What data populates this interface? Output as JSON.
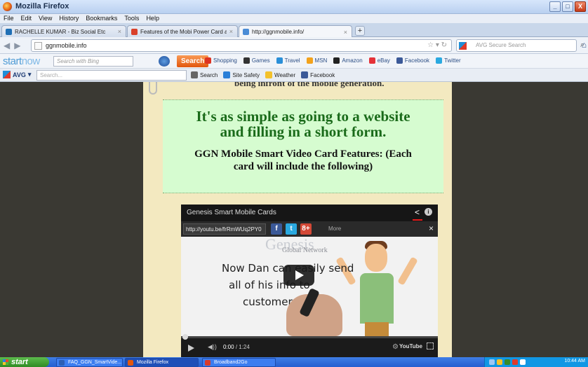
{
  "window": {
    "title": "Mozilla Firefox",
    "buttons": [
      "_",
      "□",
      "X"
    ]
  },
  "menu": [
    "File",
    "Edit",
    "View",
    "History",
    "Bookmarks",
    "Tools",
    "Help"
  ],
  "tabs": [
    {
      "label": "RACHELLE KUMAR - Biz Social Etc",
      "close": "×",
      "icon_color": "#1f6fb5"
    },
    {
      "label": "Features of the Mobi Power Card and W...",
      "close": "×",
      "icon_color": "#d9412b"
    },
    {
      "label": "http://ggnmobile.info/",
      "close": "×",
      "icon_color": "#4a8cd6"
    }
  ],
  "new_tab": "+",
  "nav": {
    "url": "ggnmobile.info",
    "search_placeholder": "AVG Secure Search"
  },
  "startnow_bar": {
    "logo_start": "start",
    "logo_now": "now",
    "search_placeholder": "Search with Bing",
    "search_button": "Search",
    "links": [
      {
        "label": "Shopping",
        "color": "#d32"
      },
      {
        "label": "Games",
        "color": "#333"
      },
      {
        "label": "Travel",
        "color": "#2a8fd8"
      },
      {
        "label": "MSN",
        "color": "#f3a21b"
      },
      {
        "label": "Amazon",
        "color": "#222"
      },
      {
        "label": "eBay",
        "color": "#e53238"
      },
      {
        "label": "Facebook",
        "color": "#3b5998"
      },
      {
        "label": "Twitter",
        "color": "#2aa9e0"
      }
    ]
  },
  "avg_bar": {
    "logo": "AVG",
    "search_placeholder": "Search...",
    "links": [
      {
        "label": "Search",
        "color": "#666"
      },
      {
        "label": "Site Safety",
        "color": "#2a7fd8"
      },
      {
        "label": "Weather",
        "color": "#f3c12b"
      },
      {
        "label": "Facebook",
        "color": "#3b5998"
      }
    ]
  },
  "page": {
    "clipped_text": "being infront of the mobile generation.",
    "headline": "It's as simple as going to a website and filling in a short form.",
    "subhead": "GGN Mobile Smart Video Card Features: (Each card will include the following)"
  },
  "video": {
    "title": "Genesis Smart Mobile Cards",
    "share_link": "http://youtu.be/frRmWUq2PY0",
    "share_buttons": [
      "f",
      "t",
      "8+"
    ],
    "more": "More",
    "close": "×",
    "brand": "Genesis",
    "brand_sub": "Global Network",
    "line1": "Now Dan can easily send",
    "line2": "all of his info to",
    "line3": "customers,",
    "time_current": "0:00",
    "time_total": "/ 1:24",
    "yt": "YouTube",
    "progress": 0.0
  },
  "taskbar": {
    "start": "start",
    "tasks": [
      {
        "label": "FAQ_GGN_SmartVide...",
        "color": "#2c5fb5"
      },
      {
        "label": "Mozilla Firefox",
        "color": "#e3570e"
      },
      {
        "label": "Broadband2Go",
        "color": "#d83b2b"
      }
    ],
    "clock": "10:44 AM"
  }
}
